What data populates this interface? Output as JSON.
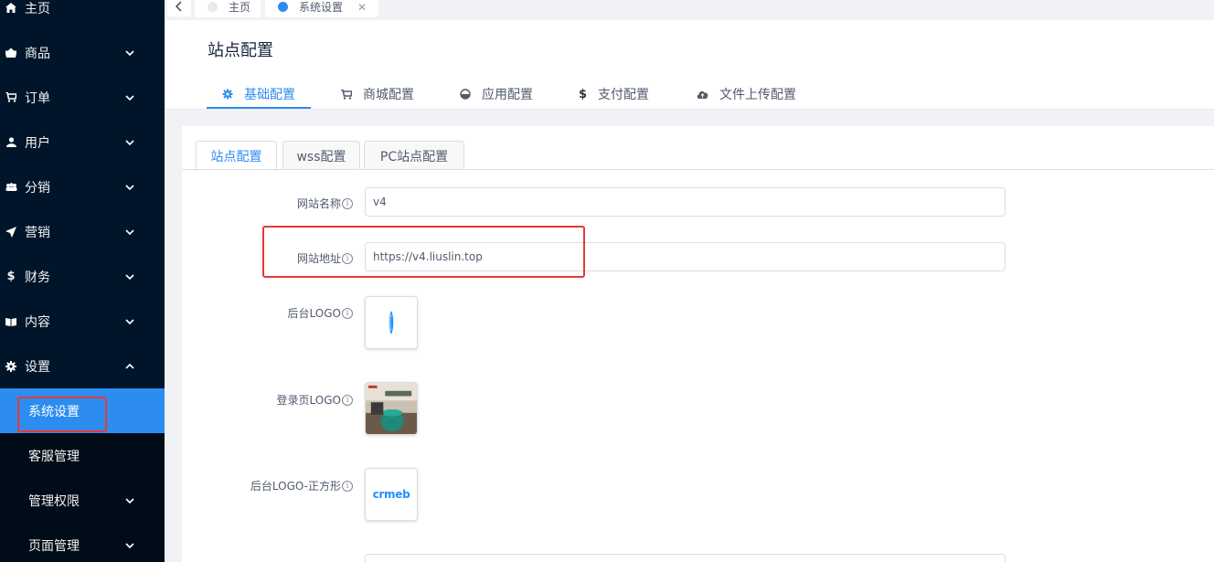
{
  "sidebar": {
    "items": [
      {
        "label": "主页",
        "icon": "home-icon"
      },
      {
        "label": "商品",
        "icon": "shop-icon"
      },
      {
        "label": "订单",
        "icon": "cart-icon"
      },
      {
        "label": "用户",
        "icon": "user-icon"
      },
      {
        "label": "分销",
        "icon": "team-icon"
      },
      {
        "label": "营销",
        "icon": "send-icon"
      },
      {
        "label": "财务",
        "icon": "dollar-icon"
      },
      {
        "label": "内容",
        "icon": "book-icon"
      },
      {
        "label": "设置",
        "icon": "gear-icon"
      }
    ],
    "sub_items": [
      {
        "label": "系统设置"
      },
      {
        "label": "客服管理"
      },
      {
        "label": "管理权限"
      },
      {
        "label": "页面管理"
      }
    ]
  },
  "tabs": [
    {
      "label": "主页"
    },
    {
      "label": "系统设置"
    }
  ],
  "page": {
    "title": "站点配置",
    "config_tabs": [
      {
        "label": "基础配置",
        "icon": "gear-icon"
      },
      {
        "label": "商城配置",
        "icon": "cart-icon"
      },
      {
        "label": "应用配置",
        "icon": "app-icon"
      },
      {
        "label": "支付配置",
        "icon": "dollar-icon"
      },
      {
        "label": "文件上传配置",
        "icon": "cloud-upload-icon"
      }
    ],
    "sub_tabs": [
      {
        "label": "站点配置"
      },
      {
        "label": "wss配置"
      },
      {
        "label": "PC站点配置"
      }
    ]
  },
  "form": {
    "site_name_label": "网站名称",
    "site_name_value": "v4",
    "site_url_label": "网站地址",
    "site_url_value": "https://v4.liuslin.top",
    "admin_logo_label": "后台LOGO",
    "login_logo_label": "登录页LOGO",
    "admin_logo_square_label": "后台LOGO-正方形",
    "square_logo_text": "crmeb",
    "info_glyph": "i"
  },
  "colors": {
    "sidebar_bg": "#001529",
    "accent": "#2d8cf0",
    "highlight_border": "#e53935"
  }
}
